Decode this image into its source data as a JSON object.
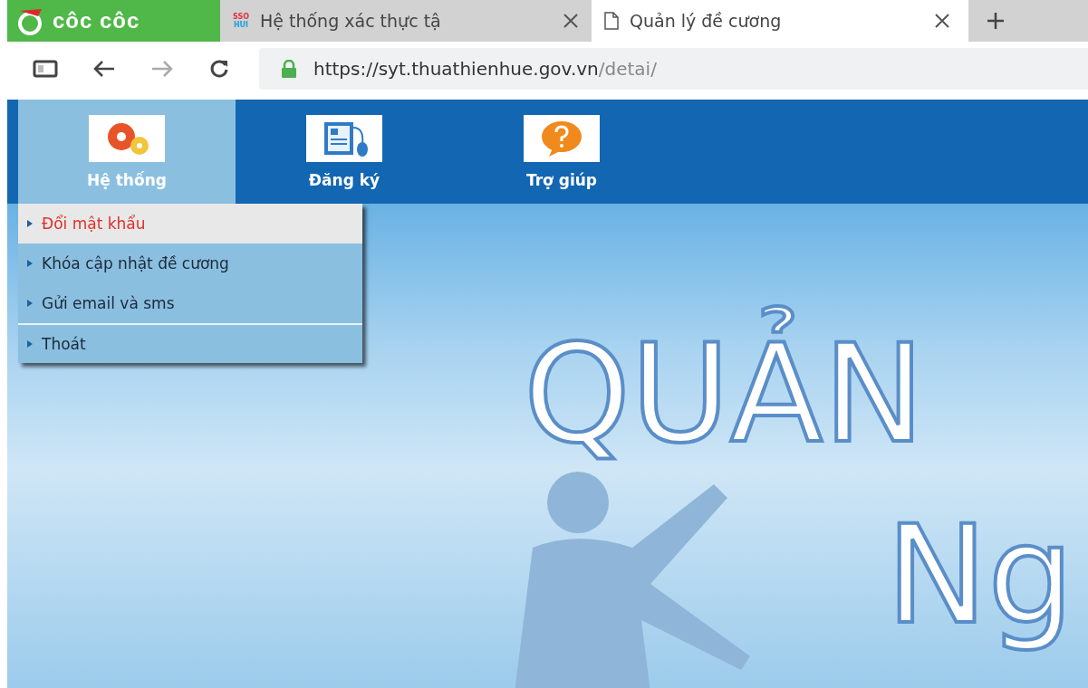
{
  "browser": {
    "logo": "côc côc",
    "tabs": [
      {
        "title": "Hệ thống xác thực tậ",
        "favicon": [
          "SSO",
          "HUI"
        ],
        "selected": false
      },
      {
        "title": "Quản lý đề cương",
        "selected": true
      }
    ],
    "address": {
      "host": "https://syt.thuathienhue.gov.vn",
      "path": "/detai/"
    }
  },
  "nav": {
    "items": [
      {
        "label": "Hệ thống",
        "kind": "gear",
        "selected": true
      },
      {
        "label": "Đăng ký",
        "kind": "form",
        "selected": false
      },
      {
        "label": "Trợ giúp",
        "kind": "help",
        "selected": false
      }
    ]
  },
  "dropdown": {
    "items": [
      {
        "label": "Đổi mật khẩu",
        "selected": true,
        "divider_above": false
      },
      {
        "label": "Khóa cập nhật đề cương",
        "selected": false,
        "divider_above": false
      },
      {
        "label": "Gửi email và sms",
        "selected": false,
        "divider_above": false
      },
      {
        "label": "Thoát",
        "selected": false,
        "divider_above": true
      }
    ]
  },
  "banner": {
    "lines": [
      "QUẢN",
      "Ng"
    ]
  }
}
